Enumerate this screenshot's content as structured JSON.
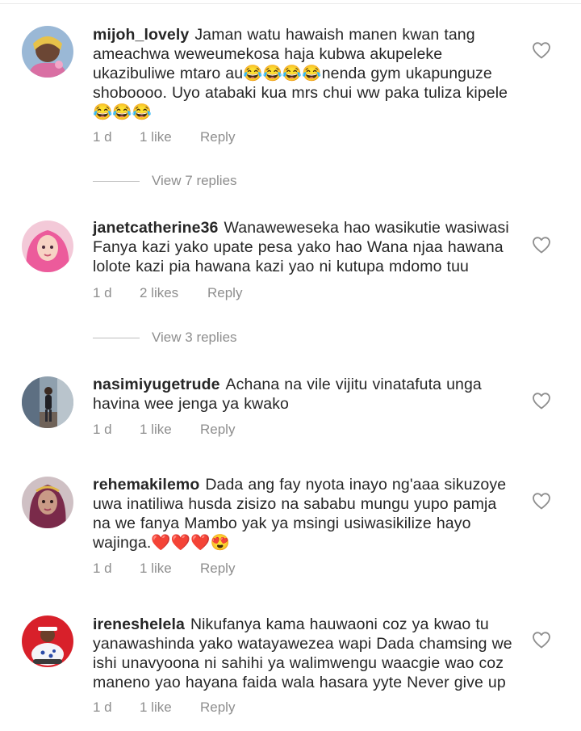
{
  "comments": [
    {
      "username": "mijoh_lovely",
      "lines": [
        "Jaman watu hawaish manen kwan tang",
        "ameachwa weweumekosa haja kubwa akupeleke",
        "ukazibuliwe mtaro au😂😂😂😂nenda gym ukapunguze",
        "shoboooo. Uyo atabaki kua mrs chui ww paka tuliza kipele",
        "😂😂😂"
      ],
      "age": "1 d",
      "likes": "1 like",
      "reply": "Reply",
      "view_replies": "View 7 replies"
    },
    {
      "username": "janetcatherine36",
      "lines": [
        "Wanaweweseka hao wasikutie wasiwasi",
        "Fanya kazi yako upate pesa yako hao Wana njaa hawana",
        "lolote kazi pia hawana kazi yao ni kutupa mdomo tuu"
      ],
      "age": "1 d",
      "likes": "2 likes",
      "reply": "Reply",
      "view_replies": "View 3 replies"
    },
    {
      "username": "nasimiyugetrude",
      "lines": [
        "Achana na vile vijitu vinatafuta unga",
        "havina wee jenga ya kwako"
      ],
      "age": "1 d",
      "likes": "1 like",
      "reply": "Reply"
    },
    {
      "username": "rehemakilemo",
      "lines": [
        "Dada ang fay nyota inayo ng'aaa sikuzoye",
        "uwa inatiliwa husda zisizo na sababu  mungu yupo pamja",
        "na we fanya Mambo yak ya msingi usiwasikilize hayo",
        "wajinga.❤️❤️❤️😍"
      ],
      "age": "1 d",
      "likes": "1 like",
      "reply": "Reply"
    },
    {
      "username": "ireneshelela",
      "lines": [
        "Nikufanya kama hauwaoni coz ya kwao tu",
        "yanawashinda yako watayawezea wapi Dada chamsing we",
        "ishi unavyoona ni sahihi ya walimwengu waacgie wao coz",
        "maneno yao hayana faida wala hasara yyte Never give up"
      ],
      "age": "1 d",
      "likes": "1 like",
      "reply": "Reply"
    }
  ],
  "icons": {
    "like": "heart-outline-icon"
  },
  "colors": {
    "text": "#262626",
    "secondary": "#8e8e8e",
    "background": "#ffffff"
  }
}
